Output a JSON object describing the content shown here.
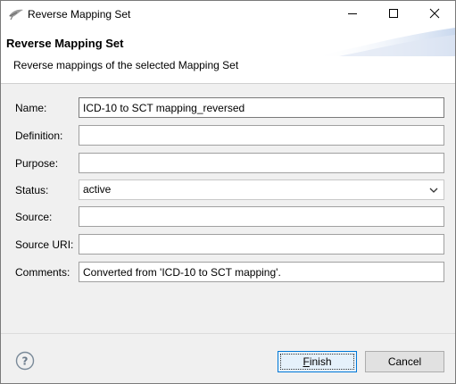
{
  "window": {
    "title": "Reverse Mapping Set"
  },
  "banner": {
    "title": "Reverse Mapping Set",
    "description": "Reverse mappings of the selected Mapping Set"
  },
  "form": {
    "name": {
      "label": "Name:",
      "value": "ICD-10 to SCT mapping_reversed"
    },
    "definition": {
      "label": "Definition:",
      "value": ""
    },
    "purpose": {
      "label": "Purpose:",
      "value": ""
    },
    "status": {
      "label": "Status:",
      "value": "active"
    },
    "source": {
      "label": "Source:",
      "value": ""
    },
    "source_uri": {
      "label": "Source URI:",
      "value": ""
    },
    "comments": {
      "label": "Comments:",
      "value": "Converted from 'ICD-10 to SCT mapping'."
    }
  },
  "footer": {
    "finish_label": "Finish",
    "cancel_label": "Cancel"
  },
  "icons": {
    "app": "feather-icon",
    "help": "help-icon",
    "minimize": "minimize-icon",
    "maximize": "maximize-icon",
    "close": "close-icon",
    "dropdown": "chevron-down-icon"
  },
  "colors": {
    "accent": "#0078d7",
    "window_bg": "#f0f0f0",
    "banner_bg": "#ffffff"
  }
}
